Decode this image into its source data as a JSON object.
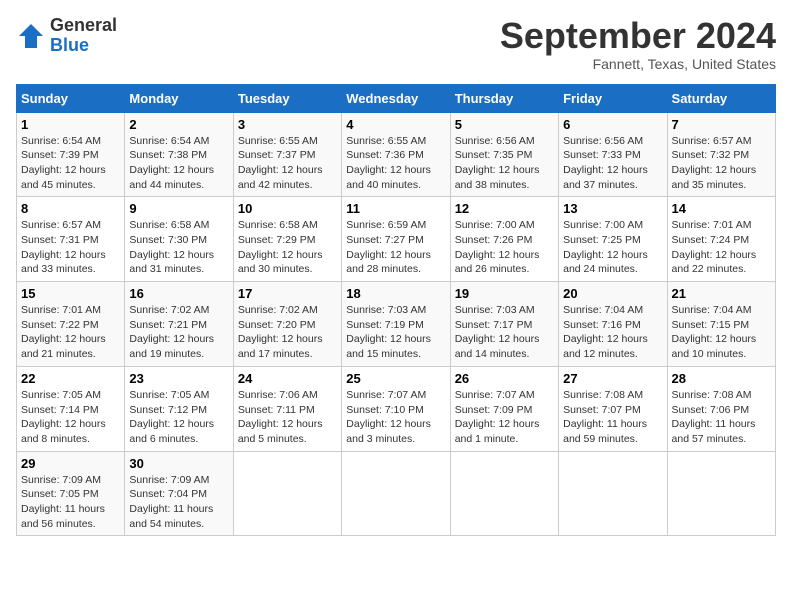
{
  "header": {
    "logo_general": "General",
    "logo_blue": "Blue",
    "month_title": "September 2024",
    "location": "Fannett, Texas, United States"
  },
  "weekdays": [
    "Sunday",
    "Monday",
    "Tuesday",
    "Wednesday",
    "Thursday",
    "Friday",
    "Saturday"
  ],
  "weeks": [
    [
      {
        "day": "1",
        "info": "Sunrise: 6:54 AM\nSunset: 7:39 PM\nDaylight: 12 hours\nand 45 minutes."
      },
      {
        "day": "2",
        "info": "Sunrise: 6:54 AM\nSunset: 7:38 PM\nDaylight: 12 hours\nand 44 minutes."
      },
      {
        "day": "3",
        "info": "Sunrise: 6:55 AM\nSunset: 7:37 PM\nDaylight: 12 hours\nand 42 minutes."
      },
      {
        "day": "4",
        "info": "Sunrise: 6:55 AM\nSunset: 7:36 PM\nDaylight: 12 hours\nand 40 minutes."
      },
      {
        "day": "5",
        "info": "Sunrise: 6:56 AM\nSunset: 7:35 PM\nDaylight: 12 hours\nand 38 minutes."
      },
      {
        "day": "6",
        "info": "Sunrise: 6:56 AM\nSunset: 7:33 PM\nDaylight: 12 hours\nand 37 minutes."
      },
      {
        "day": "7",
        "info": "Sunrise: 6:57 AM\nSunset: 7:32 PM\nDaylight: 12 hours\nand 35 minutes."
      }
    ],
    [
      {
        "day": "8",
        "info": "Sunrise: 6:57 AM\nSunset: 7:31 PM\nDaylight: 12 hours\nand 33 minutes."
      },
      {
        "day": "9",
        "info": "Sunrise: 6:58 AM\nSunset: 7:30 PM\nDaylight: 12 hours\nand 31 minutes."
      },
      {
        "day": "10",
        "info": "Sunrise: 6:58 AM\nSunset: 7:29 PM\nDaylight: 12 hours\nand 30 minutes."
      },
      {
        "day": "11",
        "info": "Sunrise: 6:59 AM\nSunset: 7:27 PM\nDaylight: 12 hours\nand 28 minutes."
      },
      {
        "day": "12",
        "info": "Sunrise: 7:00 AM\nSunset: 7:26 PM\nDaylight: 12 hours\nand 26 minutes."
      },
      {
        "day": "13",
        "info": "Sunrise: 7:00 AM\nSunset: 7:25 PM\nDaylight: 12 hours\nand 24 minutes."
      },
      {
        "day": "14",
        "info": "Sunrise: 7:01 AM\nSunset: 7:24 PM\nDaylight: 12 hours\nand 22 minutes."
      }
    ],
    [
      {
        "day": "15",
        "info": "Sunrise: 7:01 AM\nSunset: 7:22 PM\nDaylight: 12 hours\nand 21 minutes."
      },
      {
        "day": "16",
        "info": "Sunrise: 7:02 AM\nSunset: 7:21 PM\nDaylight: 12 hours\nand 19 minutes."
      },
      {
        "day": "17",
        "info": "Sunrise: 7:02 AM\nSunset: 7:20 PM\nDaylight: 12 hours\nand 17 minutes."
      },
      {
        "day": "18",
        "info": "Sunrise: 7:03 AM\nSunset: 7:19 PM\nDaylight: 12 hours\nand 15 minutes."
      },
      {
        "day": "19",
        "info": "Sunrise: 7:03 AM\nSunset: 7:17 PM\nDaylight: 12 hours\nand 14 minutes."
      },
      {
        "day": "20",
        "info": "Sunrise: 7:04 AM\nSunset: 7:16 PM\nDaylight: 12 hours\nand 12 minutes."
      },
      {
        "day": "21",
        "info": "Sunrise: 7:04 AM\nSunset: 7:15 PM\nDaylight: 12 hours\nand 10 minutes."
      }
    ],
    [
      {
        "day": "22",
        "info": "Sunrise: 7:05 AM\nSunset: 7:14 PM\nDaylight: 12 hours\nand 8 minutes."
      },
      {
        "day": "23",
        "info": "Sunrise: 7:05 AM\nSunset: 7:12 PM\nDaylight: 12 hours\nand 6 minutes."
      },
      {
        "day": "24",
        "info": "Sunrise: 7:06 AM\nSunset: 7:11 PM\nDaylight: 12 hours\nand 5 minutes."
      },
      {
        "day": "25",
        "info": "Sunrise: 7:07 AM\nSunset: 7:10 PM\nDaylight: 12 hours\nand 3 minutes."
      },
      {
        "day": "26",
        "info": "Sunrise: 7:07 AM\nSunset: 7:09 PM\nDaylight: 12 hours\nand 1 minute."
      },
      {
        "day": "27",
        "info": "Sunrise: 7:08 AM\nSunset: 7:07 PM\nDaylight: 11 hours\nand 59 minutes."
      },
      {
        "day": "28",
        "info": "Sunrise: 7:08 AM\nSunset: 7:06 PM\nDaylight: 11 hours\nand 57 minutes."
      }
    ],
    [
      {
        "day": "29",
        "info": "Sunrise: 7:09 AM\nSunset: 7:05 PM\nDaylight: 11 hours\nand 56 minutes."
      },
      {
        "day": "30",
        "info": "Sunrise: 7:09 AM\nSunset: 7:04 PM\nDaylight: 11 hours\nand 54 minutes."
      },
      {
        "day": "",
        "info": ""
      },
      {
        "day": "",
        "info": ""
      },
      {
        "day": "",
        "info": ""
      },
      {
        "day": "",
        "info": ""
      },
      {
        "day": "",
        "info": ""
      }
    ]
  ]
}
